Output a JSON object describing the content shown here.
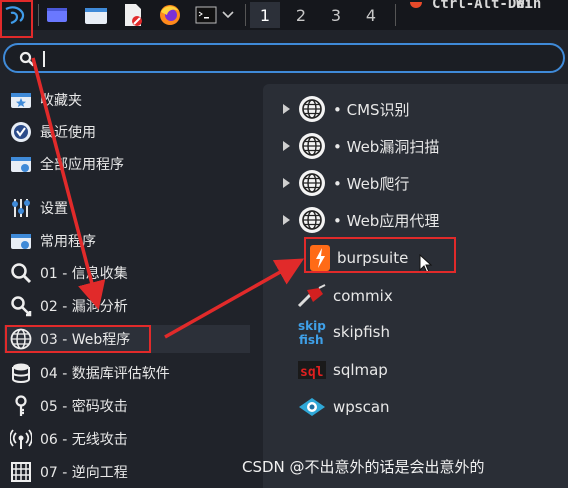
{
  "taskbar": {
    "workspaces": [
      "1",
      "2",
      "3",
      "4"
    ],
    "ctrl_alt_del": "Ctrl-Alt-Del",
    "win": "Win"
  },
  "search": {
    "value": ""
  },
  "left_menu": {
    "items": [
      {
        "label": "收藏夹",
        "icon": "star-folder-icon"
      },
      {
        "label": "最近使用",
        "icon": "recent-icon"
      },
      {
        "label": "全部应用程序",
        "icon": "folder-download-icon"
      },
      {
        "label": "设置",
        "icon": "settings-sliders-icon"
      },
      {
        "label": "常用程序",
        "icon": "folder-download-icon"
      },
      {
        "label": "01 - 信息收集",
        "icon": "magnifier-icon"
      },
      {
        "label": "02 - 漏洞分析",
        "icon": "vulnerability-icon"
      },
      {
        "label": "03 - Web程序",
        "icon": "globe-icon"
      },
      {
        "label": "04 - 数据库评估软件",
        "icon": "database-icon"
      },
      {
        "label": "05 - 密码攻击",
        "icon": "key-icon"
      },
      {
        "label": "06 - 无线攻击",
        "icon": "wireless-icon"
      },
      {
        "label": "07 - 逆向工程",
        "icon": "reverse-icon"
      }
    ]
  },
  "right_menu": {
    "items": [
      {
        "label": "• CMS识别",
        "icon": "globe-icon"
      },
      {
        "label": "• Web漏洞扫描",
        "icon": "globe-icon"
      },
      {
        "label": "• Web爬行",
        "icon": "globe-icon"
      },
      {
        "label": "• Web应用代理",
        "icon": "globe-icon"
      },
      {
        "label": "burpsuite",
        "icon": "burpsuite-icon"
      },
      {
        "label": "commix",
        "icon": "commix-icon"
      },
      {
        "label": "skipfish",
        "icon": "skipfish-icon"
      },
      {
        "label": "sqlmap",
        "icon": "sqlmap-icon"
      },
      {
        "label": "wpscan",
        "icon": "wpscan-icon"
      }
    ]
  },
  "watermark": "CSDN @不出意外的话是会出意外的",
  "colors": {
    "highlight": "#e12a2a",
    "accent": "#3f8ad8",
    "burp": "#ff6b17"
  }
}
